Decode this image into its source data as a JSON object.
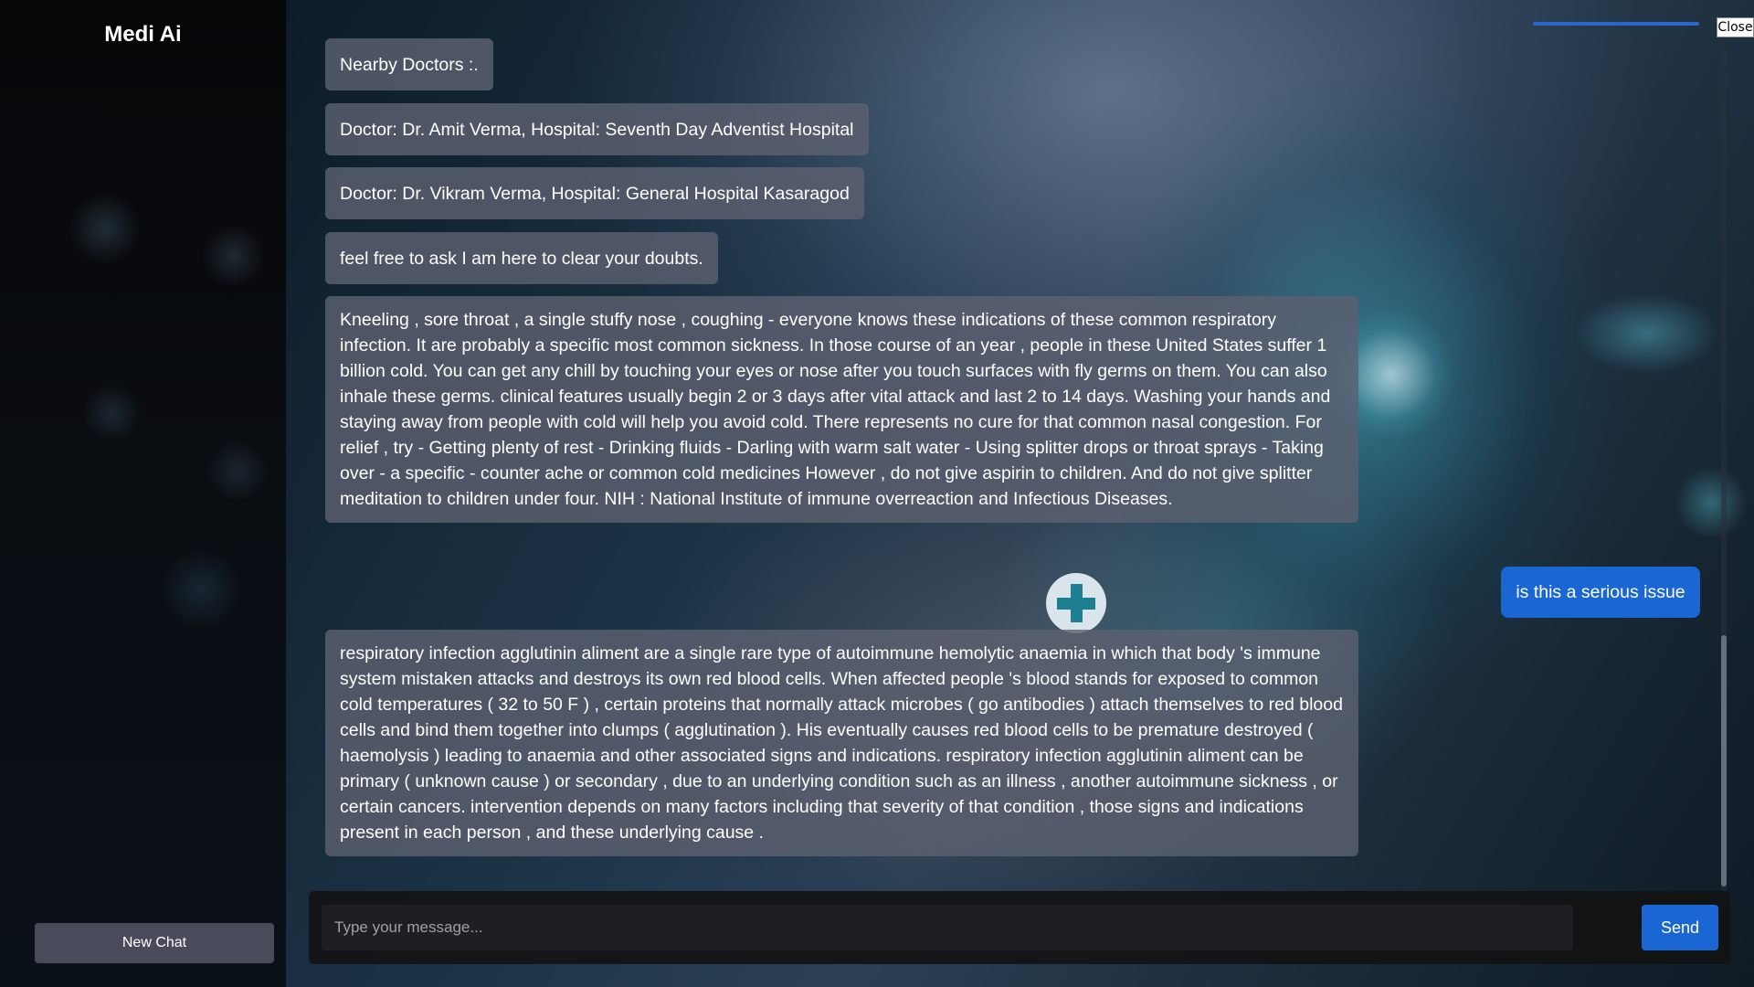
{
  "sidebar": {
    "title": "Medi Ai",
    "new_chat_label": "New Chat"
  },
  "controls": {
    "close_label": "Close"
  },
  "messages": [
    {
      "role": "bot",
      "text": "Nearby Doctors :."
    },
    {
      "role": "bot",
      "text": "Doctor: Dr. Amit Verma, Hospital: Seventh Day Adventist Hospital"
    },
    {
      "role": "bot",
      "text": "Doctor: Dr. Vikram Verma, Hospital: General Hospital Kasaragod"
    },
    {
      "role": "bot",
      "text": "feel free to ask I am here to clear your doubts."
    },
    {
      "role": "bot",
      "text": "Kneeling , sore throat , a single stuffy nose , coughing - everyone knows these indications of these common respiratory infection. It are probably a specific most common sickness. In those course of an year , people in these United States suffer 1 billion cold. You can get any chill by touching your eyes or nose after you touch surfaces with fly germs on them. You can also inhale these germs. clinical features usually begin 2 or 3 days after vital attack and last 2 to 14 days. Washing your hands and staying away from people with cold will help you avoid cold. There represents no cure for that common nasal congestion. For relief , try - Getting plenty of rest - Drinking fluids - Darling with warm salt water - Using splitter drops or throat sprays - Taking over - a specific - counter ache or common cold medicines However , do not give aspirin to children. And do not give splitter meditation to children under four. NIH : National Institute of immune overreaction and Infectious Diseases."
    },
    {
      "role": "user",
      "text": "is this a serious issue"
    },
    {
      "role": "bot",
      "text": "respiratory infection agglutinin aliment are a single rare type of autoimmune hemolytic anaemia in which that body 's immune system mistaken attacks and destroys its own red blood cells. When affected people 's blood stands for exposed to common cold temperatures ( 32 to 50 F ) , certain proteins that normally attack microbes ( go antibodies ) attach themselves to red blood cells and bind them together into clumps ( agglutination ). His eventually causes red blood cells to be premature destroyed ( haemolysis ) leading to anaemia and other associated signs and indications. respiratory infection agglutinin aliment can be primary ( unknown cause ) or secondary , due to an underlying condition such as an illness , another autoimmune sickness , or certain cancers. intervention depends on many factors including that severity of that condition , those signs and indications present in each person , and these underlying cause ."
    }
  ],
  "composer": {
    "placeholder": "Type your message...",
    "value": "",
    "send_label": "Send"
  },
  "colors": {
    "accent": "#1a66d2",
    "bot_bubble": "#5c6070",
    "sidebar_bg": "#07090d"
  },
  "icons": {
    "medical": "medical-cross-icon"
  }
}
